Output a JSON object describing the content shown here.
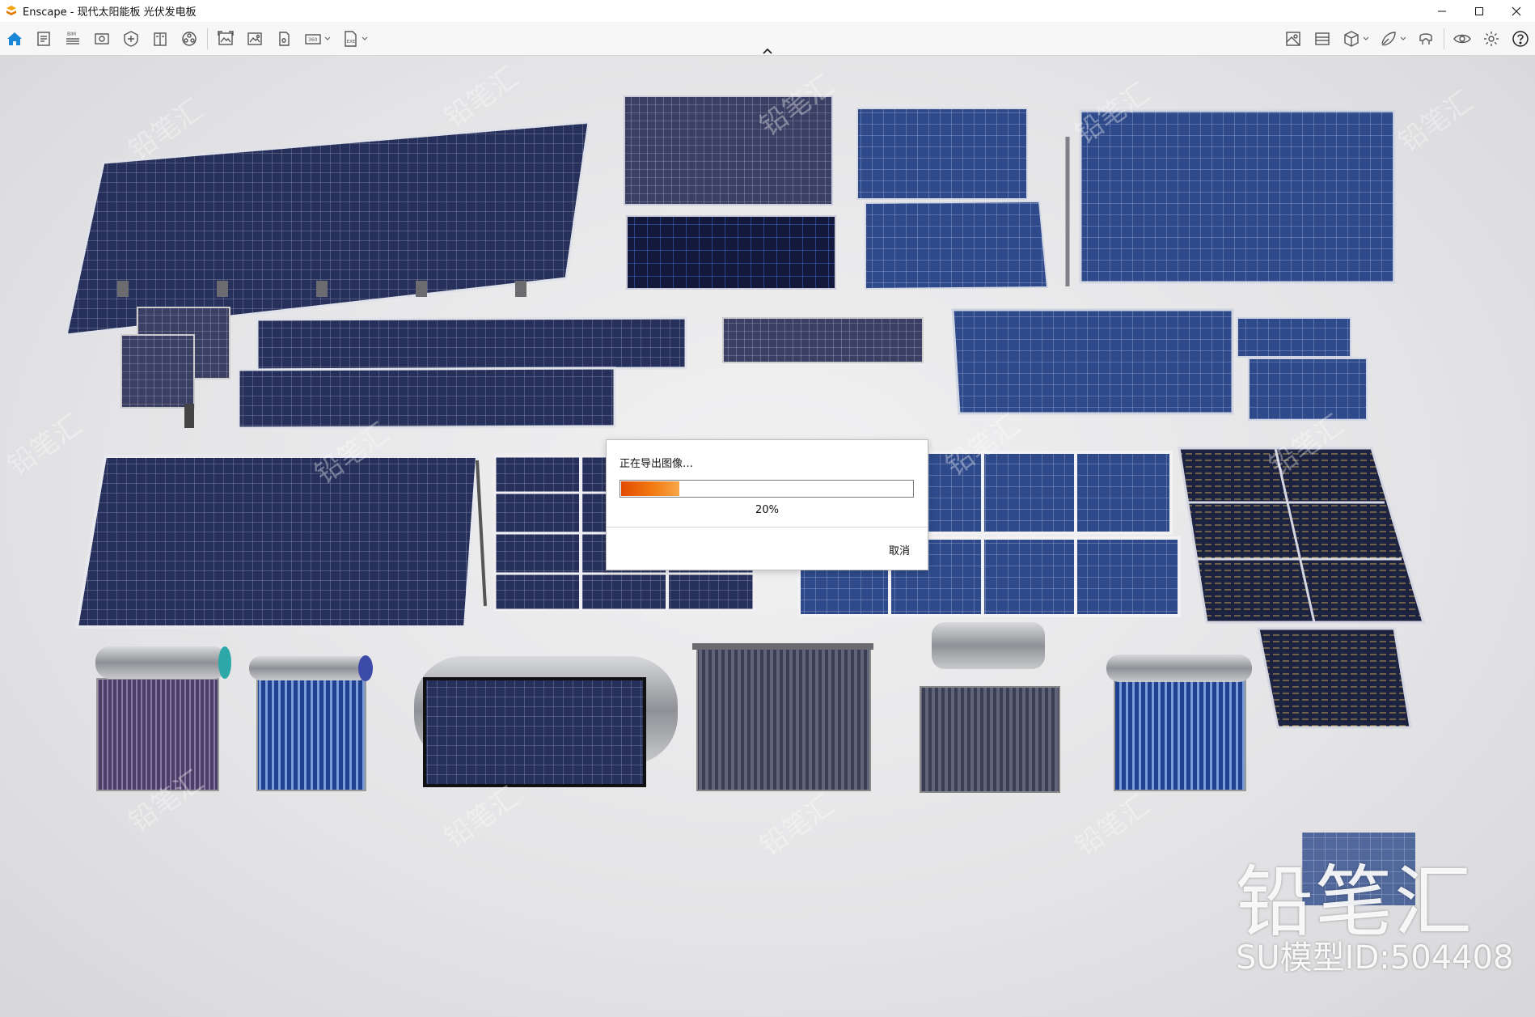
{
  "window": {
    "app_name": "Enscape",
    "title": "Enscape - 现代太阳能板 光伏发电板"
  },
  "toolbar": {
    "left_icons": [
      "home-icon",
      "documents-icon",
      "bim-icon",
      "views-icon",
      "safe-frame-icon",
      "book-icon",
      "video-icon",
      "screenshot-icon",
      "image-icon",
      "panorama-icon",
      "panorama-360-icon",
      "export-exe-icon"
    ],
    "right_icons": [
      "map-icon",
      "atmosphere-icon",
      "cube-icon",
      "materials-icon",
      "vr-headset-icon",
      "visual-settings-icon",
      "settings-icon",
      "help-icon"
    ],
    "accent_color": "#1a86d6"
  },
  "dialog": {
    "title": "正在导出图像…",
    "progress": 0.2,
    "percent_text": "20%",
    "cancel_label": "取消"
  },
  "watermark": {
    "brand": "铅笔汇",
    "model_id": "SU模型ID:504408"
  }
}
